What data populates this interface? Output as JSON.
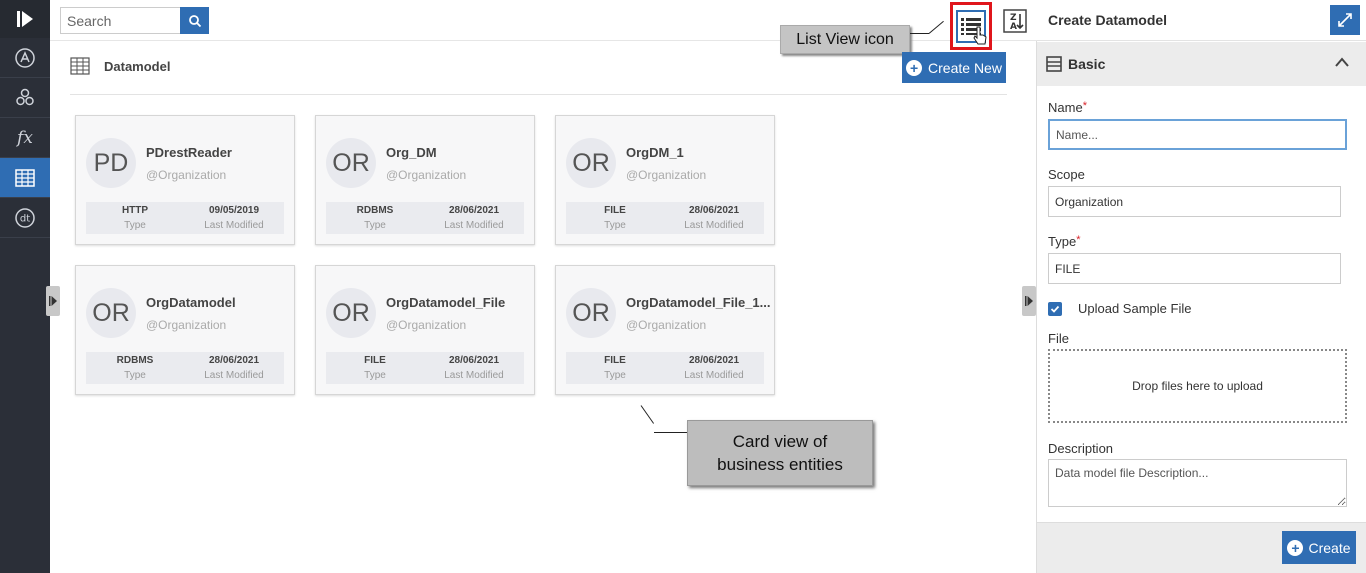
{
  "rail": {
    "items": [
      {
        "name": "logo-icon"
      },
      {
        "name": "a-circle-icon"
      },
      {
        "name": "hexagons-icon"
      },
      {
        "name": "fx-icon",
        "label": "fx"
      },
      {
        "name": "table-icon"
      },
      {
        "name": "dt-circle-icon",
        "label": "dt"
      }
    ]
  },
  "search": {
    "placeholder": "Search"
  },
  "section": {
    "title": "Datamodel",
    "create_label": "Create New"
  },
  "callouts": {
    "list_view": "List View icon",
    "card_view_line1": "Card view of",
    "card_view_line2": "business entities"
  },
  "cards": [
    {
      "initials": "PD",
      "name": "PDrestReader",
      "scope": "@Organization",
      "type": "HTTP",
      "type_label": "Type",
      "modified": "09/05/2019",
      "modified_label": "Last Modified"
    },
    {
      "initials": "OR",
      "name": "Org_DM",
      "scope": "@Organization",
      "type": "RDBMS",
      "type_label": "Type",
      "modified": "28/06/2021",
      "modified_label": "Last Modified"
    },
    {
      "initials": "OR",
      "name": "OrgDM_1",
      "scope": "@Organization",
      "type": "FILE",
      "type_label": "Type",
      "modified": "28/06/2021",
      "modified_label": "Last Modified"
    },
    {
      "initials": "OR",
      "name": "OrgDatamodel",
      "scope": "@Organization",
      "type": "RDBMS",
      "type_label": "Type",
      "modified": "28/06/2021",
      "modified_label": "Last Modified"
    },
    {
      "initials": "OR",
      "name": "OrgDatamodel_File",
      "scope": "@Organization",
      "type": "FILE",
      "type_label": "Type",
      "modified": "28/06/2021",
      "modified_label": "Last Modified"
    },
    {
      "initials": "OR",
      "name": "OrgDatamodel_File_1...",
      "scope": "@Organization",
      "type": "FILE",
      "type_label": "Type",
      "modified": "28/06/2021",
      "modified_label": "Last Modified"
    }
  ],
  "panel": {
    "title": "Create Datamodel",
    "section": "Basic",
    "name_label": "Name",
    "name_placeholder": "Name...",
    "scope_label": "Scope",
    "scope_value": "Organization",
    "type_label": "Type",
    "type_value": "FILE",
    "upload_label": "Upload Sample File",
    "upload_checked": true,
    "file_label": "File",
    "dropzone_text": "Drop files here to upload",
    "description_label": "Description",
    "description_placeholder": "Data model file Description...",
    "create_label": "Create",
    "required_mark": "*"
  },
  "colors": {
    "accent": "#2f6db3",
    "rail": "#2b2f38",
    "highlight": "#e0151b"
  }
}
